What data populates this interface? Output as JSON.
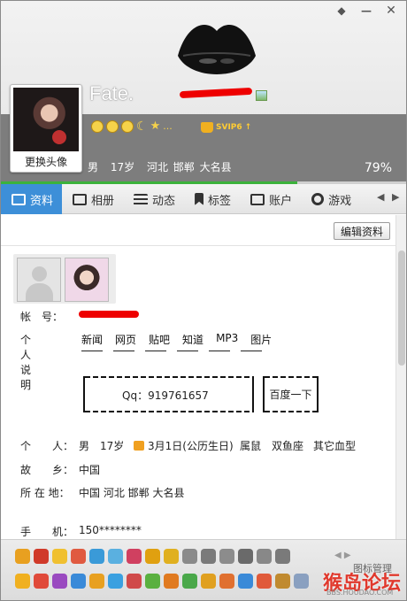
{
  "header": {
    "username": "Fate.",
    "change_avatar_label": "更换头像",
    "svip_label": "SVIP6",
    "emoji_more": "...",
    "gender": "男",
    "age": "17岁",
    "location": "河北 邯郸 大名县",
    "completeness": "79%"
  },
  "tabs": [
    {
      "label": "资料",
      "icon": "profile-card-icon"
    },
    {
      "label": "相册",
      "icon": "album-icon"
    },
    {
      "label": "动态",
      "icon": "feed-icon"
    },
    {
      "label": "标签",
      "icon": "tag-icon"
    },
    {
      "label": "账户",
      "icon": "account-icon"
    },
    {
      "label": "游戏",
      "icon": "game-icon"
    }
  ],
  "tab_nav": {
    "prev": "◀",
    "next": "▶"
  },
  "content": {
    "edit_button": "编辑资料",
    "account_label": "帐　号：",
    "intro_label": "个人说明",
    "intro_links": [
      "新闻",
      "网页",
      "贴吧",
      "知道",
      "MP3",
      "图片"
    ],
    "search_text": "Qq：919761657",
    "search_button": "百度一下",
    "personal_label": "个　　人：",
    "personal_gender": "男",
    "personal_age": "17岁",
    "birthday": "3月1日(公历生日)",
    "zodiac_animal": "属鼠",
    "constellation": "双鱼座",
    "blood_type": "其它血型",
    "hometown_label": "故　　乡：",
    "hometown": "中国",
    "residence_label": "所 在 地：",
    "residence": "中国 河北 邯郸 大名县",
    "phone_label": "手　　机：",
    "phone": "150********"
  },
  "emoticon_bar": {
    "manage_label": "图标管理",
    "pager": "◀ ▶"
  },
  "watermark": {
    "main": "猴岛论坛",
    "sub": "BBS.HOUDAO.COM"
  },
  "colors": {
    "accent": "#3d8fd8",
    "progress": "#3cb23c",
    "redaction": "#e00000"
  }
}
